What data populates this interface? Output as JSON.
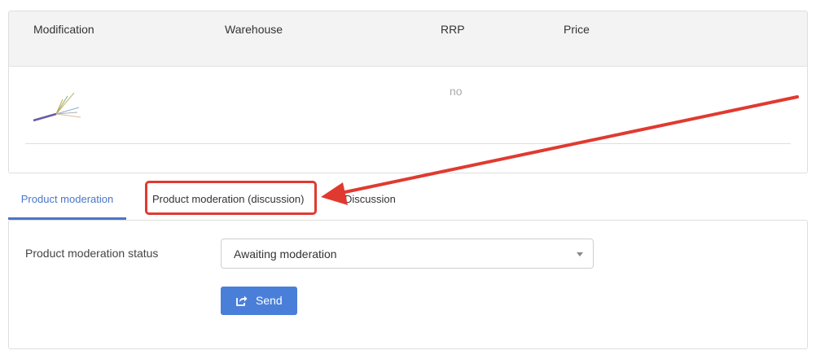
{
  "table": {
    "columns": [
      "Modification",
      "Warehouse",
      "RRP",
      "Price"
    ],
    "row": {
      "rrp": "no"
    }
  },
  "tabs": [
    {
      "label": "Product moderation",
      "active": true
    },
    {
      "label": "Product moderation (discussion)",
      "highlighted": true
    },
    {
      "label": "Discussion"
    }
  ],
  "moderation": {
    "status_label": "Product moderation status",
    "status_value": "Awaiting moderation",
    "send_label": "Send"
  },
  "icons": {
    "product_thumbnail": "cable-thumbnail",
    "send": "share-square-icon",
    "dropdown": "caret-down-icon"
  },
  "colors": {
    "accent": "#4a76c8",
    "button": "#4a7fd9",
    "annotation": "#e03a30"
  }
}
